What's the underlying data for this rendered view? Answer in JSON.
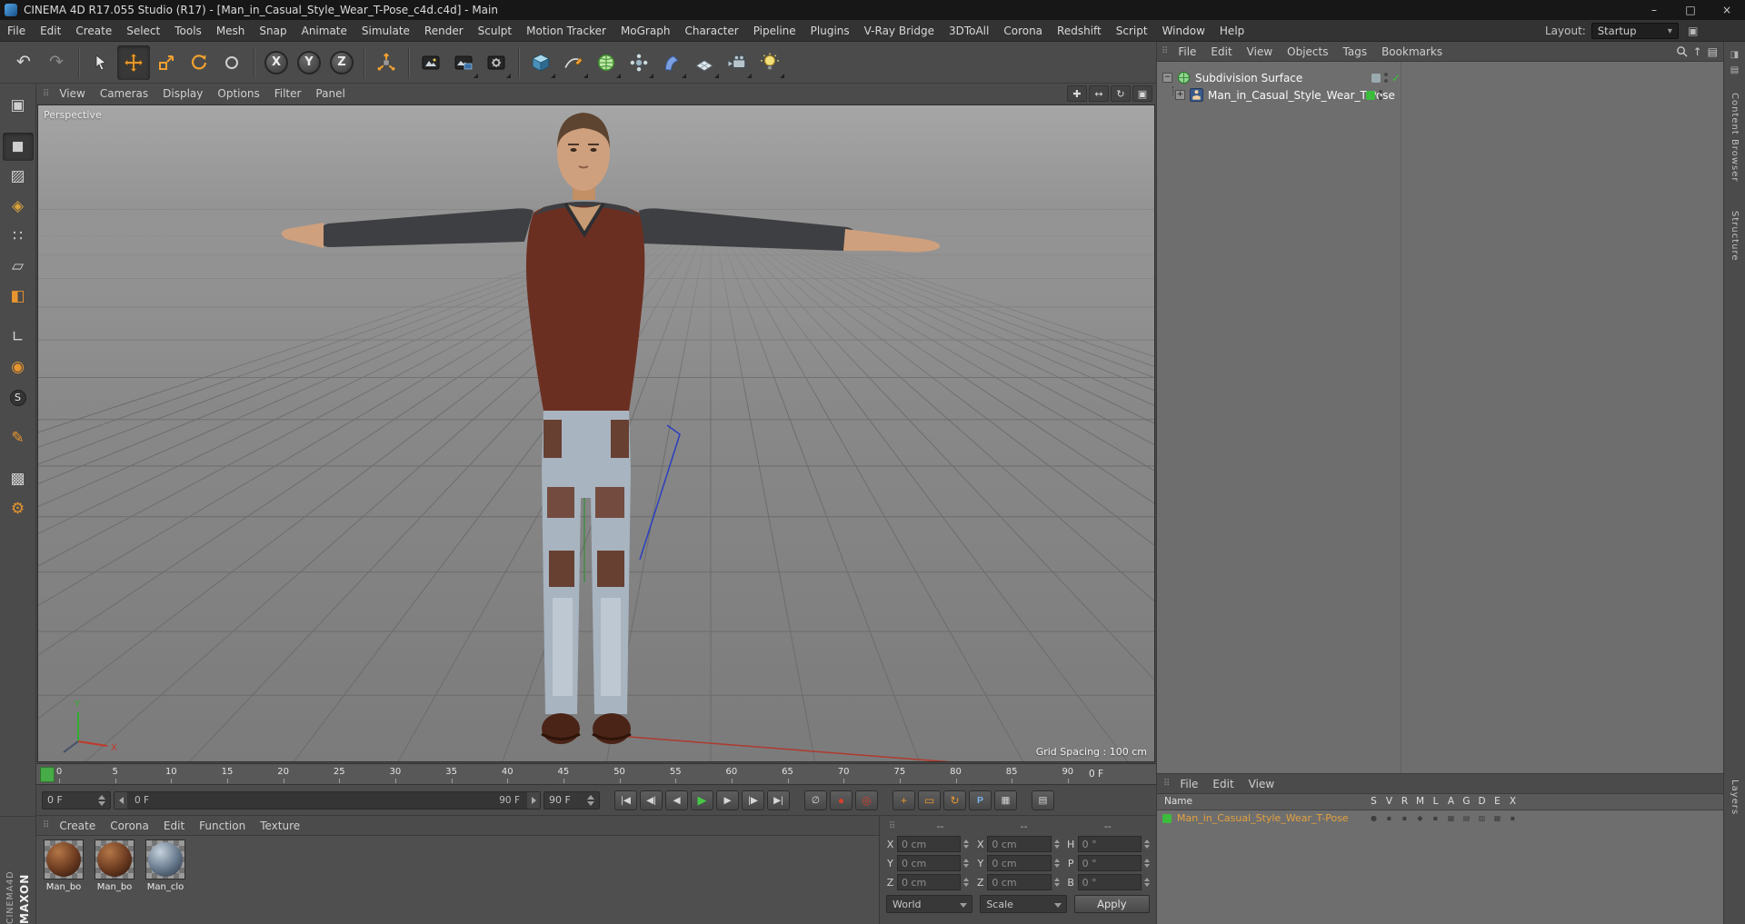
{
  "window": {
    "title": "CINEMA 4D R17.055 Studio (R17) - [Man_in_Casual_Style_Wear_T-Pose_c4d.c4d] - Main"
  },
  "menubar": {
    "items": [
      "File",
      "Edit",
      "Create",
      "Select",
      "Tools",
      "Mesh",
      "Snap",
      "Animate",
      "Simulate",
      "Render",
      "Sculpt",
      "Motion Tracker",
      "MoGraph",
      "Character",
      "Pipeline",
      "Plugins",
      "V-Ray Bridge",
      "3DToAll",
      "Corona",
      "Redshift",
      "Script",
      "Window",
      "Help"
    ],
    "layout_label": "Layout:",
    "layout_value": "Startup"
  },
  "toolbar": {
    "axis_x": "X",
    "axis_y": "Y",
    "axis_z": "Z"
  },
  "viewport": {
    "menus": [
      "View",
      "Cameras",
      "Display",
      "Options",
      "Filter",
      "Panel"
    ],
    "camera_label": "Perspective",
    "grid_spacing": "Grid Spacing : 100 cm",
    "axis_x": "X",
    "axis_y": "Y"
  },
  "object_manager": {
    "menus": [
      "File",
      "Edit",
      "View",
      "Objects",
      "Tags",
      "Bookmarks"
    ],
    "objects": [
      {
        "name": "Subdivision Surface"
      },
      {
        "name": "Man_in_Casual_Style_Wear_T-Pose"
      }
    ]
  },
  "timeline": {
    "ticks": [
      "0",
      "5",
      "10",
      "15",
      "20",
      "25",
      "30",
      "35",
      "40",
      "45",
      "50",
      "55",
      "60",
      "65",
      "70",
      "75",
      "80",
      "85",
      "90"
    ],
    "current": "0 F",
    "start_field": "0 F",
    "range_start": "0 F",
    "range_end": "90 F",
    "end_field": "90 F"
  },
  "materials": {
    "menus": [
      "Create",
      "Corona",
      "Edit",
      "Function",
      "Texture"
    ],
    "items": [
      {
        "label": "Man_bo",
        "variant": "brown"
      },
      {
        "label": "Man_bo",
        "variant": "brown"
      },
      {
        "label": "Man_clo",
        "variant": "denim"
      }
    ]
  },
  "coordinates": {
    "headers": [
      "--",
      "--",
      "--"
    ],
    "rows": [
      {
        "l1": "X",
        "v1": "0 cm",
        "l2": "X",
        "v2": "0 cm",
        "l3": "H",
        "v3": "0 °"
      },
      {
        "l1": "Y",
        "v1": "0 cm",
        "l2": "Y",
        "v2": "0 cm",
        "l3": "P",
        "v3": "0 °"
      },
      {
        "l1": "Z",
        "v1": "0 cm",
        "l2": "Z",
        "v2": "0 cm",
        "l3": "B",
        "v3": "0 °"
      }
    ],
    "space_mode": "World",
    "size_mode": "Scale",
    "apply_label": "Apply"
  },
  "layers": {
    "menus": [
      "File",
      "Edit",
      "View"
    ],
    "name_header": "Name",
    "columns": [
      "S",
      "V",
      "R",
      "M",
      "L",
      "A",
      "G",
      "D",
      "E",
      "X"
    ],
    "toggles": [
      "●",
      "▪",
      "▪",
      "◆",
      "▪",
      "▦",
      "▤",
      "▥",
      "▦",
      "▪"
    ],
    "items": [
      {
        "name": "Man_in_Casual_Style_Wear_T-Pose"
      }
    ]
  },
  "branding": {
    "maxon": "MAXON",
    "cinema": "CINEMA4D"
  },
  "right_strip": {
    "tabs": [
      "Content Browser",
      "Structure"
    ],
    "bottom_tab": "Layers"
  },
  "icons": {
    "undo": "↶",
    "redo": "↷",
    "win_min": "–",
    "win_max": "□",
    "win_close": "×",
    "grip": "⠿",
    "expand_minus": "−",
    "expand_plus": "+",
    "check": "✓",
    "t_start": "|◀",
    "t_prevkey": "◀|",
    "t_prev": "◀",
    "t_play": "▶",
    "t_next": "▶",
    "t_nextkey": "|▶",
    "t_end": "▶|",
    "t_nokey": "∅",
    "t_record": "●",
    "t_autokey": "◎",
    "t_pos": "+",
    "t_scale": "▭",
    "t_rot": "↻",
    "t_param": "P",
    "t_pla": "▦",
    "t_keysel": "▤",
    "vp_pan": "✚",
    "vp_zoom": "↔",
    "vp_rot": "↻",
    "vp_max": "▣",
    "pal_make": "▣",
    "pal_model": "◼",
    "pal_texture": "▨",
    "pal_uv": "◈",
    "pal_points": "∷",
    "pal_edges": "▱",
    "pal_polys": "◧",
    "pal_axis": "∟",
    "pal_mouse": "◉",
    "pal_snap": "S",
    "pal_paint": "✎",
    "pal_lock": "▩",
    "pal_gear": "⚙",
    "om_up": "↑",
    "om_grid": "▤",
    "menubar_panel": "▣",
    "strip_pin": "◨",
    "strip_grid": "▤"
  }
}
